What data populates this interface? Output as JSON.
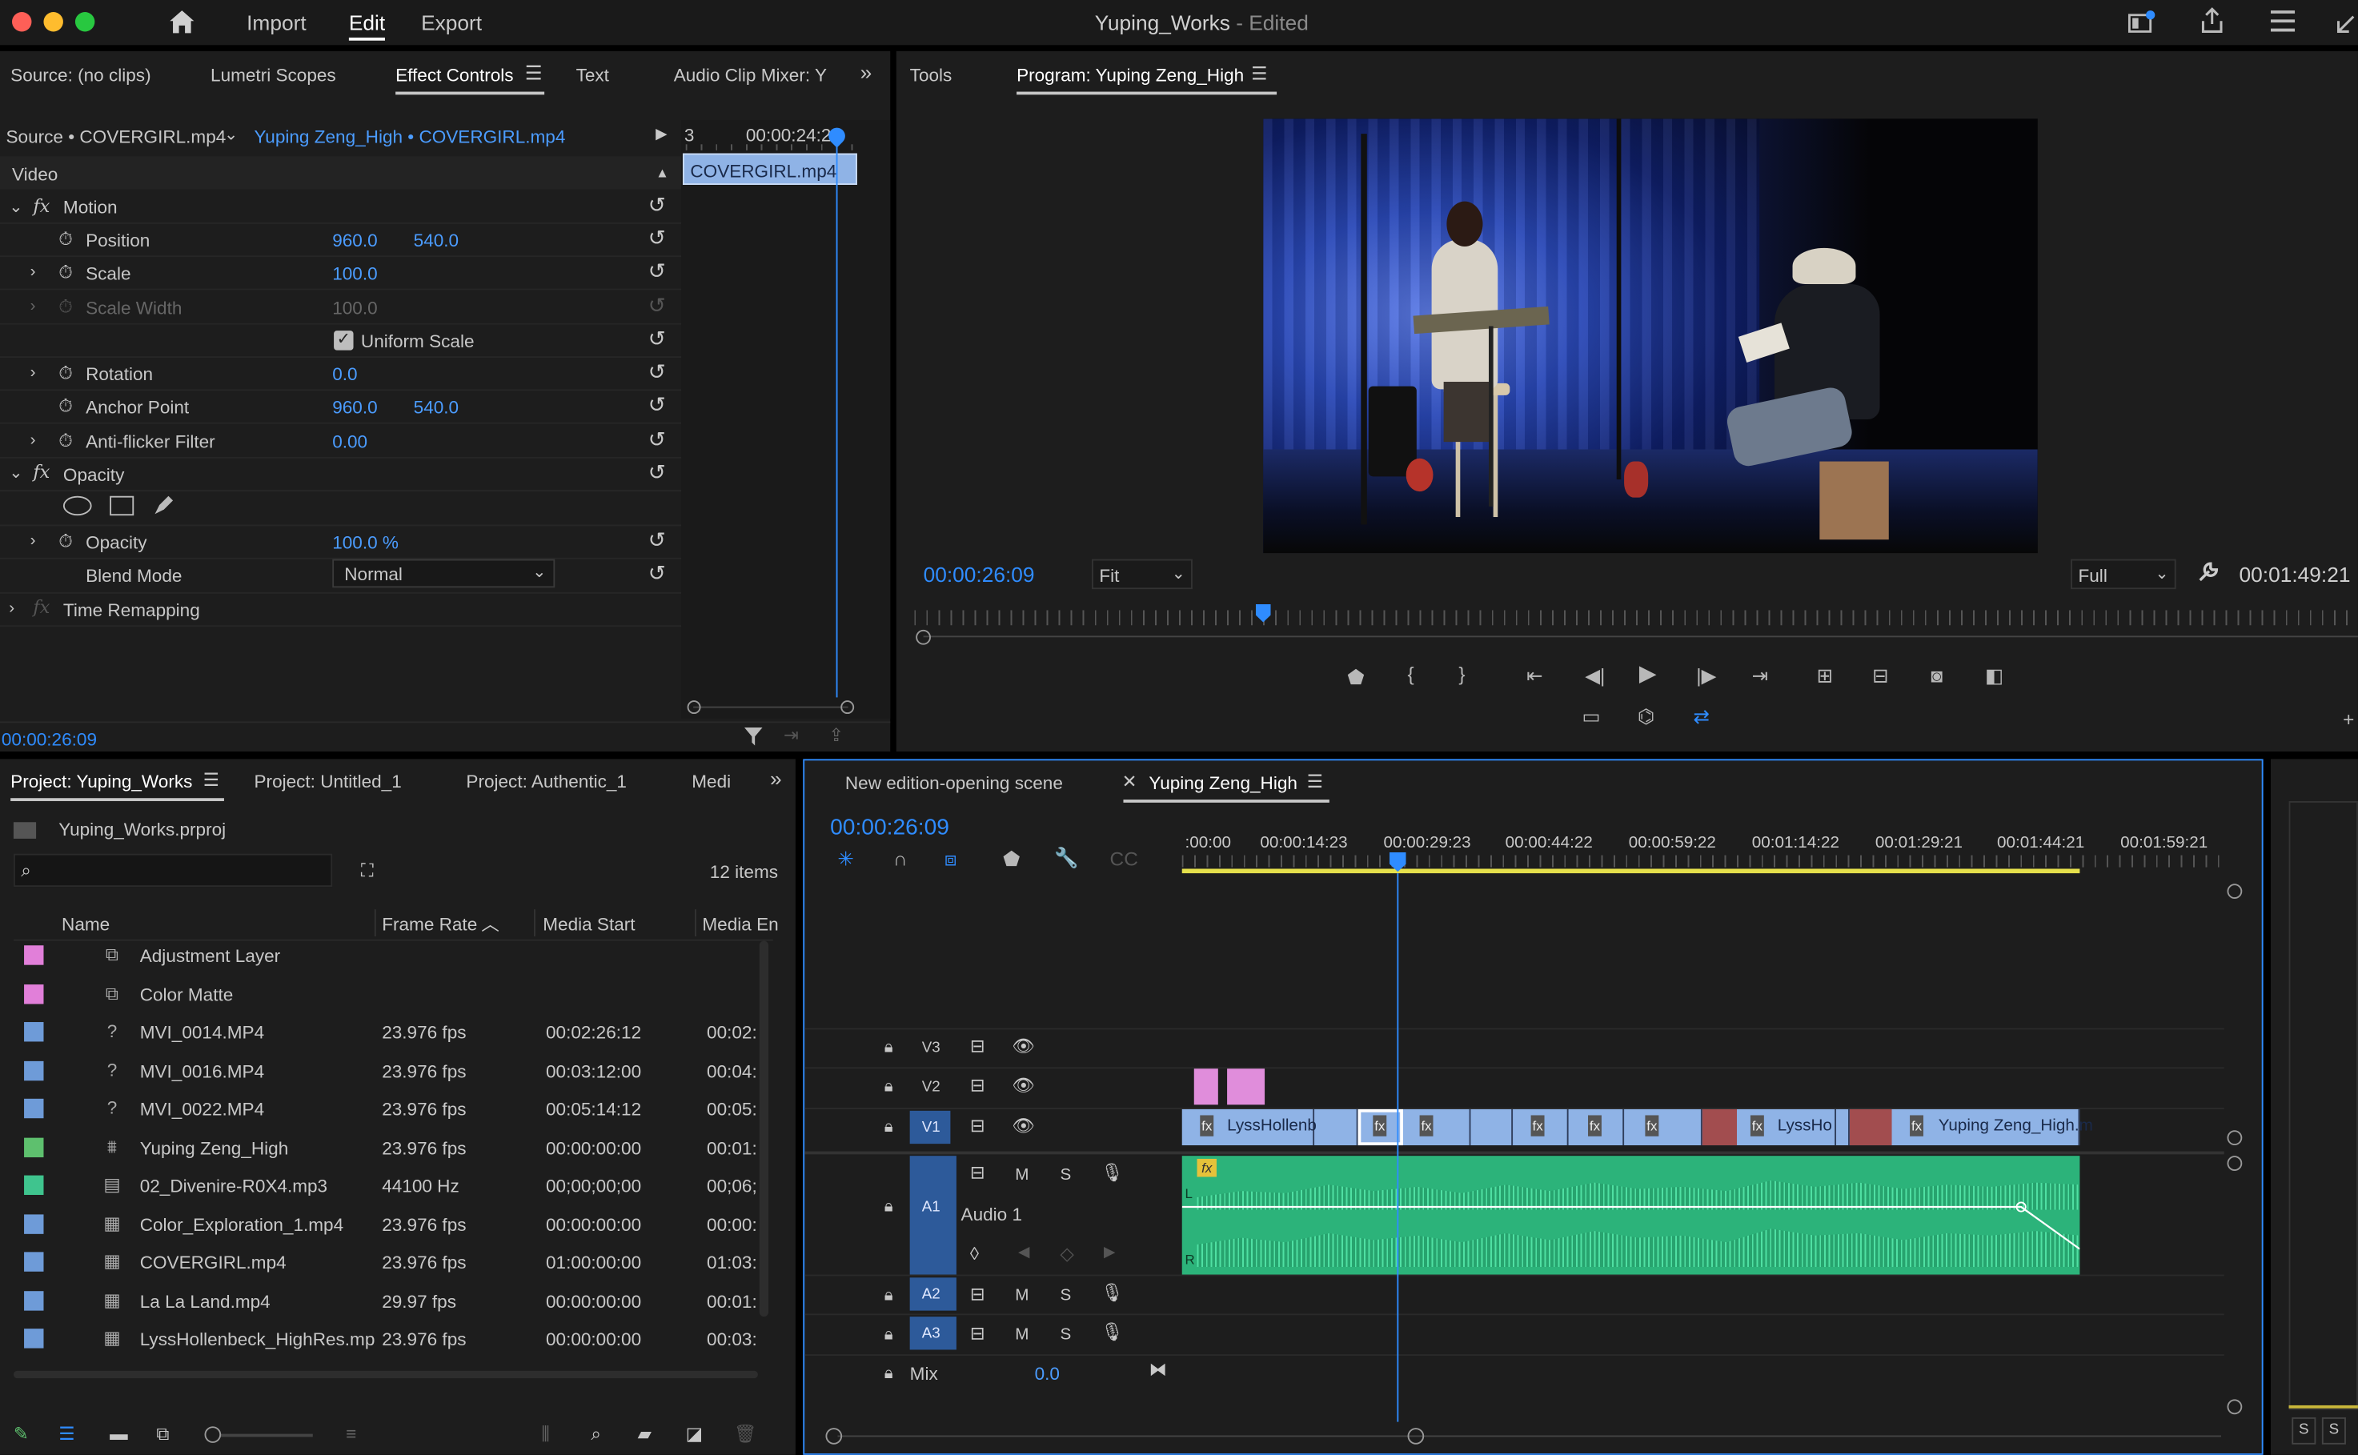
{
  "app": {
    "menu": {
      "import": "Import",
      "edit": "Edit",
      "export": "Export"
    },
    "title": "Yuping_Works",
    "title_suffix": " - Edited"
  },
  "effect_panel": {
    "tabs": [
      "Source: (no clips)",
      "Lumetri Scopes",
      "Effect Controls",
      "Text",
      "Audio Clip Mixer: Y"
    ],
    "source_label": "Source • COVERGIRL.mp4",
    "seq_label": "Yuping Zeng_High • COVERGIRL.mp4",
    "mini_time_left": "3",
    "mini_time": "00:00:24:2",
    "clip_name": "COVERGIRL.mp4",
    "video_label": "Video",
    "rows": {
      "motion": "Motion",
      "position": "Position",
      "position_x": "960.0",
      "position_y": "540.0",
      "scale": "Scale",
      "scale_v": "100.0",
      "scale_width": "Scale Width",
      "scale_width_v": "100.0",
      "uniform_scale": "Uniform Scale",
      "rotation": "Rotation",
      "rotation_v": "0.0",
      "anchor": "Anchor Point",
      "anchor_x": "960.0",
      "anchor_y": "540.0",
      "antiflicker": "Anti-flicker Filter",
      "antiflicker_v": "0.00",
      "opacity_group": "Opacity",
      "opacity": "Opacity",
      "opacity_v": "100.0 %",
      "blend": "Blend Mode",
      "blend_v": "Normal",
      "time_remap": "Time Remapping"
    },
    "timecode": "00:00:26:09"
  },
  "program": {
    "tools_tab": "Tools",
    "tab": "Program: Yuping Zeng_High",
    "timecode": "00:00:26:09",
    "fit": "Fit",
    "quality": "Full",
    "duration": "00:01:49:21"
  },
  "project": {
    "tabs": [
      "Project: Yuping_Works",
      "Project: Untitled_1",
      "Project: Authentic_1",
      "Medi"
    ],
    "file": "Yuping_Works.prproj",
    "search_placeholder": "",
    "count": "12 items",
    "columns": [
      "Name",
      "Frame Rate",
      "Media Start",
      "Media En"
    ],
    "rows": [
      {
        "color": "#e17fd9",
        "icon": "adjustment-layer-icon",
        "name": "Adjustment Layer",
        "fps": "",
        "start": "",
        "end": ""
      },
      {
        "color": "#e17fd9",
        "icon": "color-matte-icon",
        "name": "Color Matte",
        "fps": "",
        "start": "",
        "end": ""
      },
      {
        "color": "#6e9bd8",
        "icon": "offline-file-icon",
        "name": "MVI_0014.MP4",
        "fps": "23.976 fps",
        "start": "00:02:26:12",
        "end": "00:02:"
      },
      {
        "color": "#6e9bd8",
        "icon": "offline-file-icon",
        "name": "MVI_0016.MP4",
        "fps": "23.976 fps",
        "start": "00:03:12:00",
        "end": "00:04:"
      },
      {
        "color": "#6e9bd8",
        "icon": "offline-file-icon",
        "name": "MVI_0022.MP4",
        "fps": "23.976 fps",
        "start": "00:05:14:12",
        "end": "00:05:"
      },
      {
        "color": "#5ec06e",
        "icon": "sequence-icon",
        "name": "Yuping Zeng_High",
        "fps": "23.976 fps",
        "start": "00:00:00:00",
        "end": "00:01:"
      },
      {
        "color": "#3fc48e",
        "icon": "audio-file-icon",
        "name": "02_Divenire-R0X4.mp3",
        "fps": "44100 Hz",
        "start": "00;00;00;00",
        "end": "00;06;"
      },
      {
        "color": "#6e9bd8",
        "icon": "video-file-icon",
        "name": "Color_Exploration_1.mp4",
        "fps": "23.976 fps",
        "start": "00:00:00:00",
        "end": "00:00:"
      },
      {
        "color": "#6e9bd8",
        "icon": "video-file-icon",
        "name": "COVERGIRL.mp4",
        "fps": "23.976 fps",
        "start": "01:00:00:00",
        "end": "01:03:"
      },
      {
        "color": "#6e9bd8",
        "icon": "video-file-icon",
        "name": "La La Land.mp4",
        "fps": "29.97 fps",
        "start": "00:00:00:00",
        "end": "00:01:"
      },
      {
        "color": "#6e9bd8",
        "icon": "video-file-icon",
        "name": "LyssHollenbeck_HighRes.mp",
        "fps": "23.976 fps",
        "start": "00:00:00:00",
        "end": "00:03:"
      }
    ]
  },
  "timeline": {
    "tabs": [
      "New edition-opening scene",
      "Yuping Zeng_High"
    ],
    "timecode": "00:00:26:09",
    "ruler": [
      ":00:00",
      "00:00:14:23",
      "00:00:29:23",
      "00:00:44:22",
      "00:00:59:22",
      "00:01:14:22",
      "00:01:29:21",
      "00:01:44:21",
      "00:01:59:21"
    ],
    "tracks": {
      "v3": "V3",
      "v2": "V2",
      "v1": "V1",
      "a1": "A1",
      "a2": "A2",
      "a3": "A3"
    },
    "track_btn": {
      "m": "M",
      "s": "S"
    },
    "audio_name": "Audio 1",
    "mix_label": "Mix",
    "mix_value": "0.0",
    "clips": {
      "lyss1": "LyssHollenb",
      "lyss2": "LyssHo",
      "yz": "Yuping Zeng_High.m"
    },
    "fx": "fx",
    "l": "L",
    "r": "R"
  },
  "right_meters": {
    "s1": "S",
    "s2": "S"
  }
}
